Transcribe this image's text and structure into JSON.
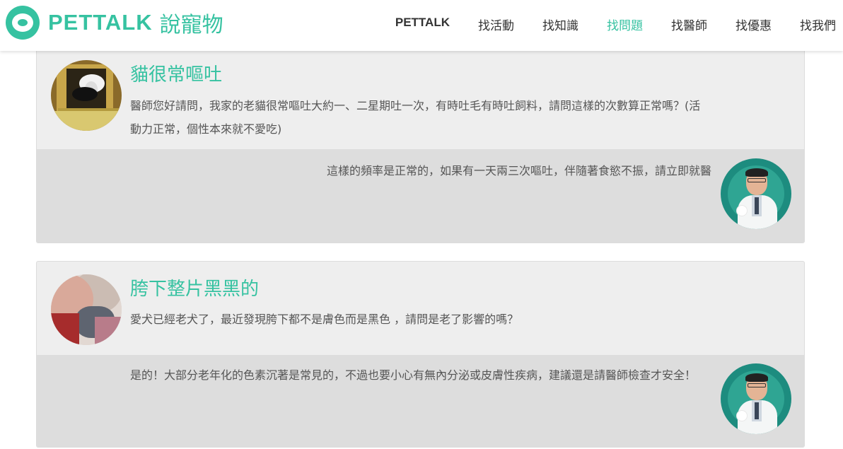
{
  "header": {
    "logo_text": "PETTALK",
    "logo_sub": "說寵物",
    "nav": [
      {
        "label": "PETTALK"
      },
      {
        "label": "找活動"
      },
      {
        "label": "找知識"
      },
      {
        "label": "找問題"
      },
      {
        "label": "找醫師"
      },
      {
        "label": "找優惠"
      },
      {
        "label": "找我們"
      }
    ],
    "active_nav": "找問題"
  },
  "colors": {
    "accent": "#36c2a1",
    "card_question_bg": "#eeeeee",
    "card_answer_bg": "#dddddd",
    "text": "#555555"
  },
  "posts": [
    {
      "title": "貓很常嘔吐",
      "question": "醫師您好請問，我家的老貓很常嘔吐大約一、二星期吐一次，有時吐毛有時吐飼料，請問這樣的次數算正常嗎？(活動力正常，個性本來就不愛吃)",
      "answer": "這樣的頻率是正常的，如果有一天兩三次嘔吐，伴隨著食慾不振，請立即就醫"
    },
    {
      "title": "胯下整片黑黑的",
      "question": "愛犬已經老犬了，最近發現胯下都不是膚色而是黑色 ，請問是老了影響的嗎？",
      "answer": "是的！大部分老年化的色素沉著是常見的，不過也要小心有無內分泌或皮膚性疾病，建議還是請醫師檢查才安全！"
    }
  ]
}
